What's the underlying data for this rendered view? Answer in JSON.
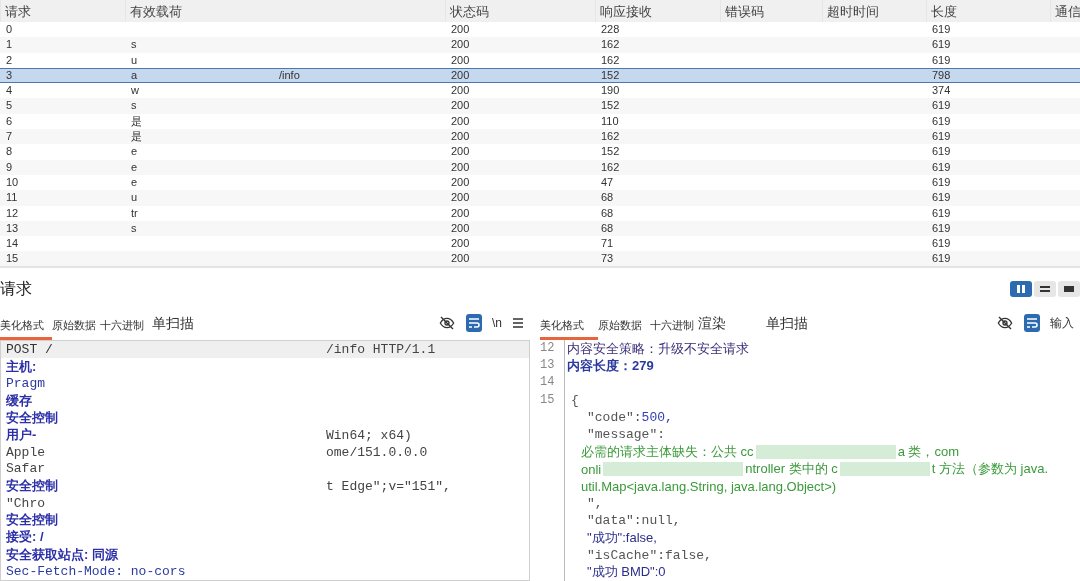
{
  "table": {
    "columns": [
      "请求",
      "有效载荷",
      "状态码",
      "响应接收",
      "错误码",
      "超时时间",
      "长度",
      "通信"
    ],
    "rows": [
      {
        "request": "0",
        "status": "200",
        "received": "228",
        "length": "619",
        "selected": false
      },
      {
        "request": "1",
        "payload": [
          "s"
        ],
        "status": "200",
        "received": "162",
        "length": "619",
        "selected": false
      },
      {
        "request": "2",
        "payload": [
          "u"
        ],
        "status": "200",
        "received": "162",
        "length": "619",
        "selected": false
      },
      {
        "request": "3",
        "payload": [
          "a",
          "/info"
        ],
        "status": "200",
        "received": "152",
        "length": "798",
        "selected": true
      },
      {
        "request": "4",
        "payload": [
          "w"
        ],
        "status": "200",
        "received": "190",
        "length": "374",
        "selected": false
      },
      {
        "request": "5",
        "payload": [
          "s"
        ],
        "status": "200",
        "received": "152",
        "length": "619",
        "selected": false
      },
      {
        "request": "6",
        "payload": [
          "是"
        ],
        "status": "200",
        "received": "110",
        "length": "619",
        "selected": false
      },
      {
        "request": "7",
        "payload": [
          "是"
        ],
        "status": "200",
        "received": "162",
        "length": "619",
        "selected": false
      },
      {
        "request": "8",
        "payload": [
          "e"
        ],
        "status": "200",
        "received": "152",
        "length": "619",
        "selected": false
      },
      {
        "request": "9",
        "payload": [
          "e"
        ],
        "status": "200",
        "received": "162",
        "length": "619",
        "selected": false
      },
      {
        "request": "10",
        "payload": [
          "e"
        ],
        "status": "200",
        "received": "47",
        "length": "619",
        "selected": false
      },
      {
        "request": "11",
        "payload": [
          "u"
        ],
        "status": "200",
        "received": "68",
        "length": "619",
        "selected": false
      },
      {
        "request": "12",
        "payload": [
          "tr"
        ],
        "status": "200",
        "received": "68",
        "length": "619",
        "selected": false
      },
      {
        "request": "13",
        "payload": [
          "s"
        ],
        "status": "200",
        "received": "68",
        "length": "619",
        "selected": false
      },
      {
        "request": "14",
        "status": "200",
        "received": "71",
        "length": "619",
        "selected": false
      },
      {
        "request": "15",
        "status": "200",
        "received": "73",
        "length": "619",
        "selected": false
      }
    ]
  },
  "layout_toggles": [
    {
      "selected": true
    },
    {
      "selected": false
    },
    {
      "selected": false
    }
  ],
  "request_pane": {
    "title": "请求",
    "tabs": [
      {
        "label": "美化格式",
        "selected": true
      },
      {
        "label": "原始数据",
        "selected": false
      },
      {
        "label": "十六进制",
        "selected": false
      },
      {
        "label": "单扫描",
        "selected": false
      }
    ],
    "newline_toggle": "\\n",
    "lines": [
      {
        "kind": "request-line",
        "segments": [
          "POST /",
          "/info HTTP/1.1"
        ]
      },
      {
        "kind": "header",
        "segments": [
          "主机:"
        ]
      },
      {
        "kind": "name",
        "segments": [
          "Pragm"
        ]
      },
      {
        "kind": "header",
        "segments": [
          "缓存"
        ]
      },
      {
        "kind": "header",
        "segments": [
          "安全控制"
        ]
      },
      {
        "kind": "header",
        "segments": [
          "用户-",
          "Win64; x64)"
        ]
      },
      {
        "kind": "text",
        "segments": [
          "Apple",
          "ome/151.0.0.0"
        ]
      },
      {
        "kind": "text",
        "segments": [
          "Safar"
        ]
      },
      {
        "kind": "header",
        "segments": [
          "安全控制",
          "t Edge\";v=\"151\","
        ]
      },
      {
        "kind": "text",
        "segments": [
          "\"Chro"
        ]
      },
      {
        "kind": "header",
        "segments": [
          "安全控制"
        ]
      },
      {
        "kind": "header",
        "segments": [
          "接受: /"
        ]
      },
      {
        "kind": "header",
        "segments": [
          "安全获取站点: 同源"
        ]
      },
      {
        "kind": "name",
        "segments": [
          "Sec-Fetch-Mode: no-cors"
        ]
      }
    ]
  },
  "response_pane": {
    "tabs": [
      {
        "label": "美化格式",
        "selected": true
      },
      {
        "label": "原始数据",
        "selected": false
      },
      {
        "label": "十六进制",
        "selected": false
      },
      {
        "label": "渲染",
        "selected": false
      },
      {
        "label": "单扫描",
        "selected": false
      }
    ],
    "input_label": "输入",
    "lines": [
      {
        "num": "12",
        "kind": "meta",
        "segments": [
          "内容安全策略：升级不安全请求"
        ]
      },
      {
        "num": "13",
        "kind": "meta-blue",
        "segments": [
          "内容长度：279"
        ]
      },
      {
        "num": "14",
        "kind": "blank"
      },
      {
        "num": "15",
        "kind": "json",
        "segments": [
          "{"
        ]
      },
      {
        "kind": "json",
        "segments": [
          "\"code\":",
          "500,"
        ]
      },
      {
        "kind": "json",
        "segments": [
          "\"message\":"
        ]
      },
      {
        "kind": "message",
        "segments": [
          "必需的请求主体缺失：公共 cc",
          "a 类，com"
        ]
      },
      {
        "kind": "message",
        "segments": [
          "onli",
          "ntroller 类中的 c",
          "t 方法（参数为 java."
        ]
      },
      {
        "kind": "message",
        "segments": [
          "util.Map<java.lang.String, java.lang.Object>)"
        ]
      },
      {
        "kind": "json",
        "segments": [
          "\","
        ]
      },
      {
        "kind": "json",
        "segments": [
          "\"data\":null,"
        ]
      },
      {
        "kind": "json-cjk",
        "segments": [
          "\"成功\":false,"
        ]
      },
      {
        "kind": "json",
        "segments": [
          "\"isCache\":false,"
        ]
      },
      {
        "kind": "json-cjk",
        "segments": [
          "\"成功 BMD\":0"
        ]
      }
    ]
  }
}
